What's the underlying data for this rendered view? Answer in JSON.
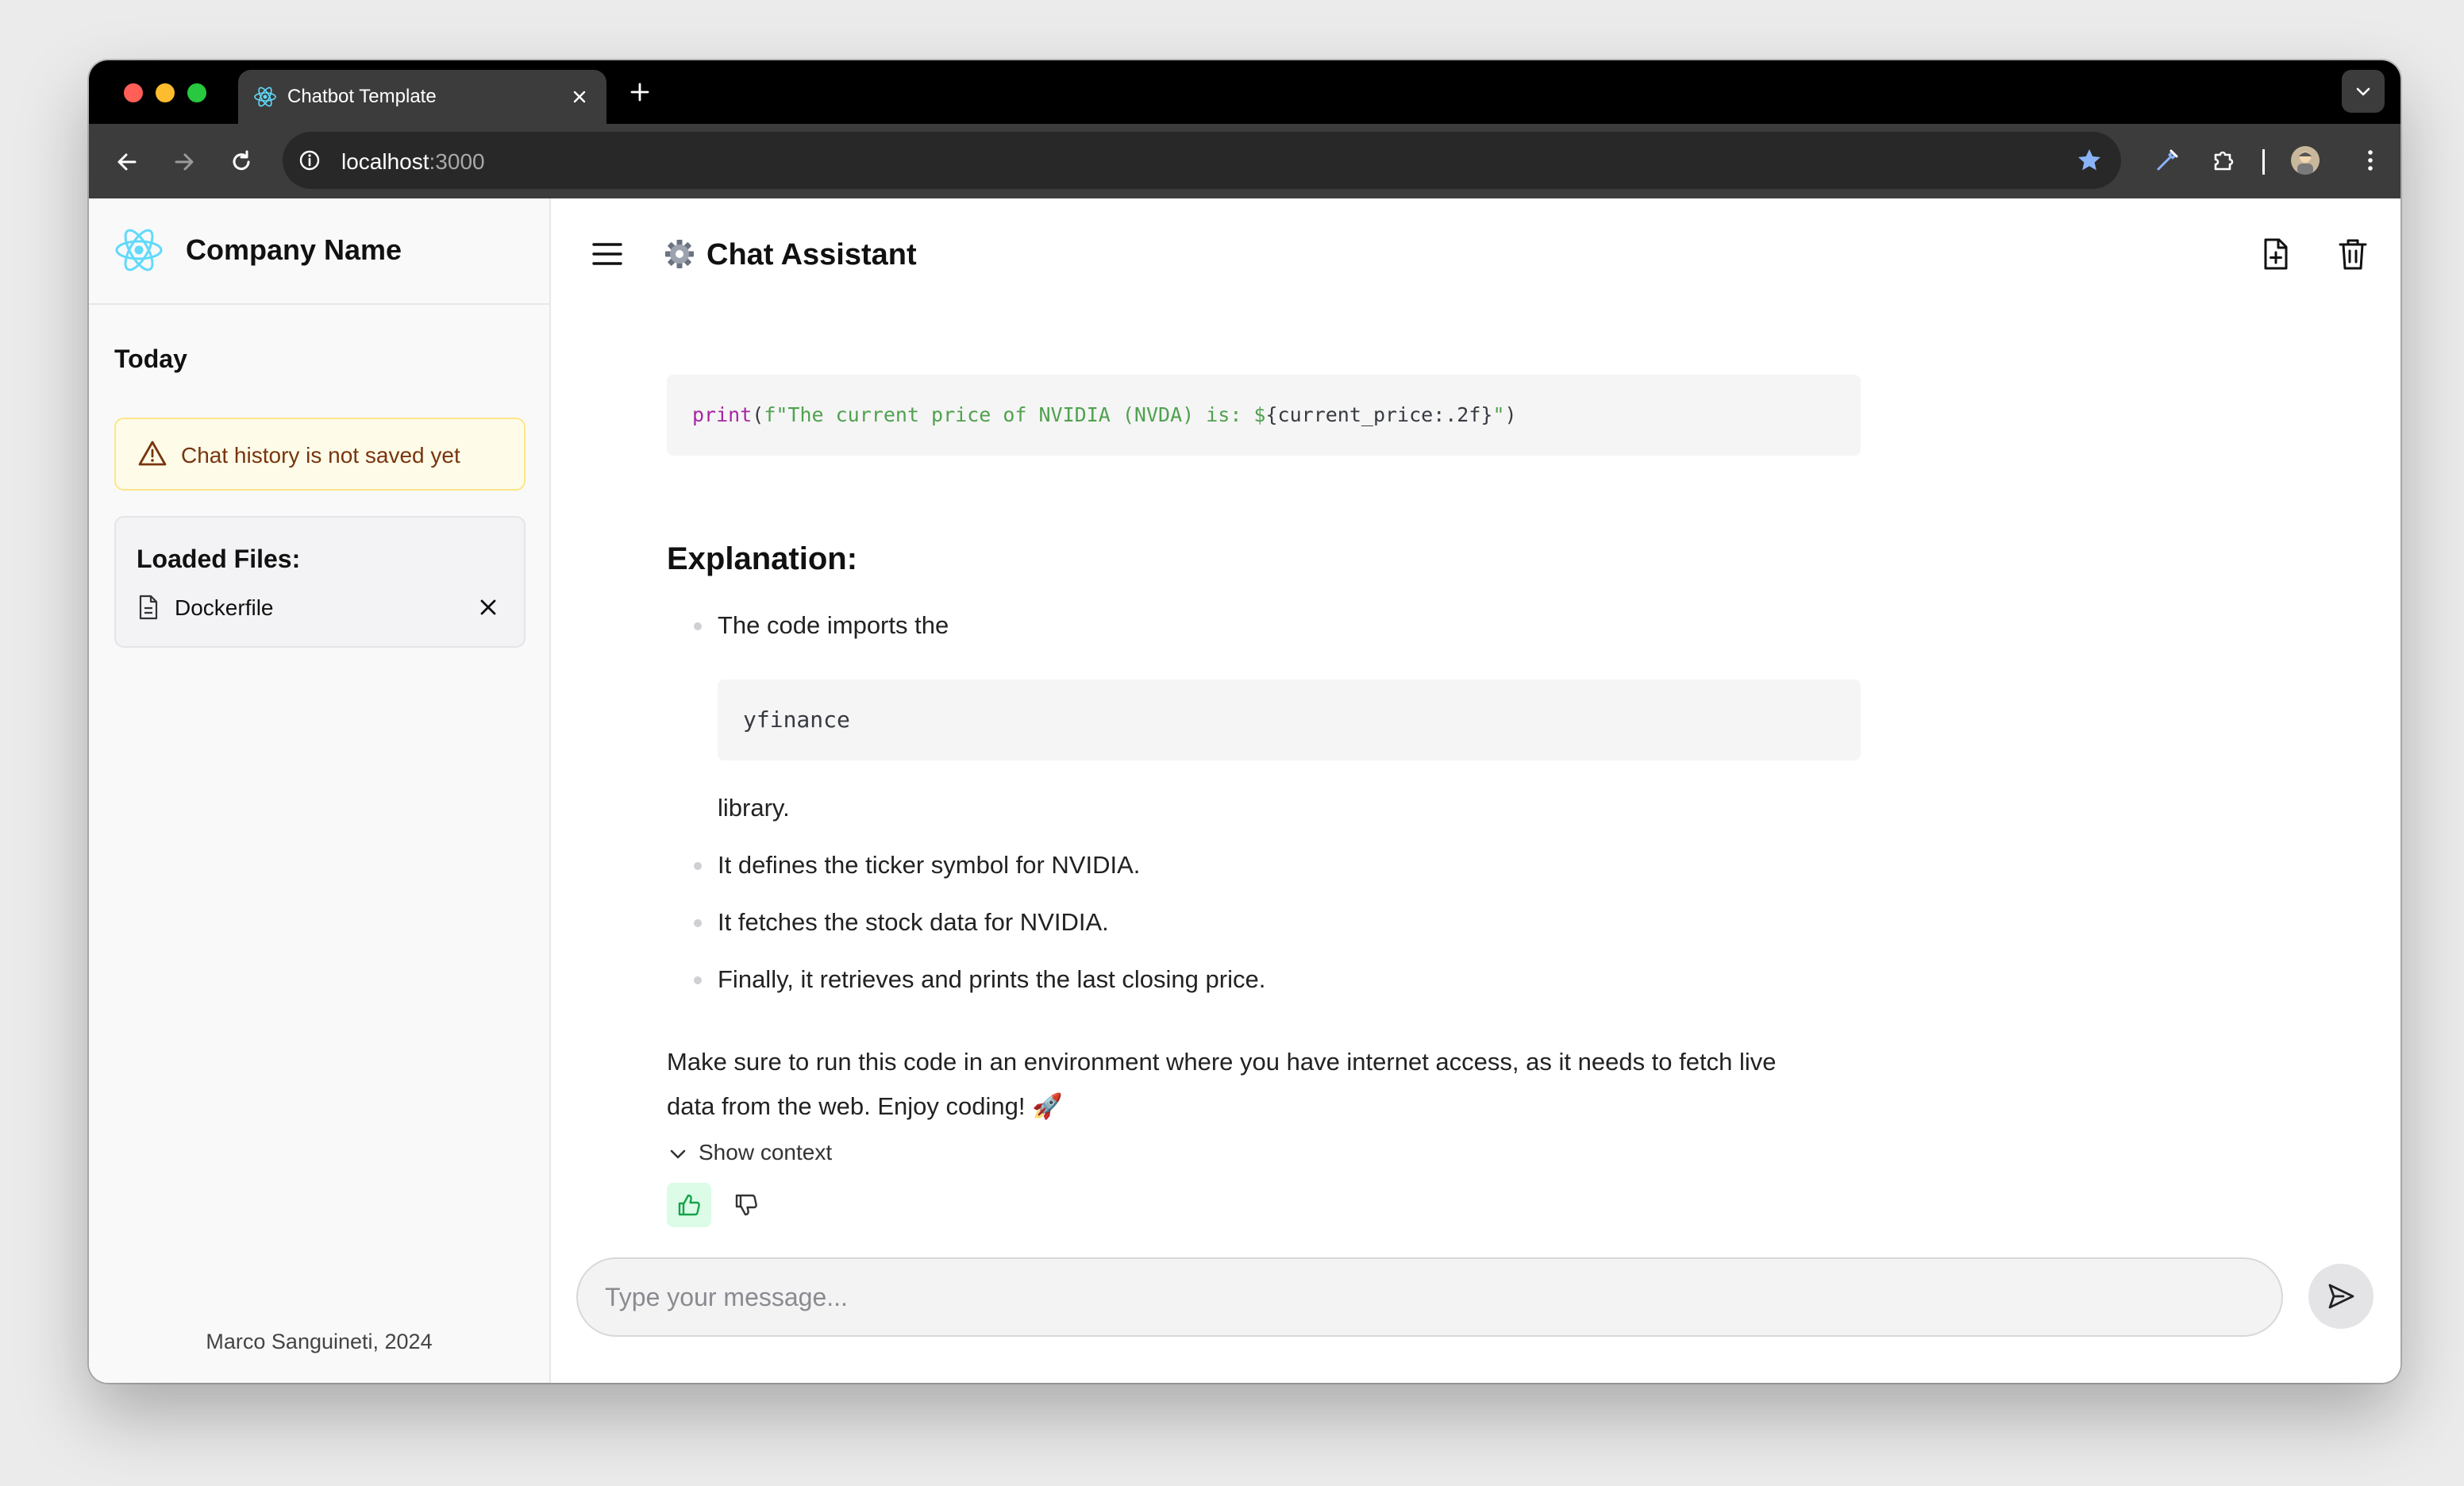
{
  "browser": {
    "tab_title": "Chatbot Template",
    "url_host": "localhost",
    "url_port": ":3000"
  },
  "sidebar": {
    "company_name": "Company Name",
    "section_today": "Today",
    "warning_text": "Chat history is not saved yet",
    "loaded_files_title": "Loaded Files:",
    "files": [
      "Dockerfile"
    ],
    "footer": "Marco Sanguineti, 2024"
  },
  "header": {
    "title": "Chat Assistant"
  },
  "message": {
    "code_print": {
      "fn": "print",
      "open": "(",
      "string_part": "f\"The current price of NVIDIA (NVDA) is: $",
      "expr_part": "{current_price:.2f}",
      "close_quote": "\"",
      "close": ")"
    },
    "explanation_heading": "Explanation:",
    "bullet_1_before": "The code imports the",
    "bullet_1_code": "yfinance",
    "bullet_1_after": "library.",
    "bullet_2": "It defines the ticker symbol for NVIDIA.",
    "bullet_3": "It fetches the stock data for NVIDIA.",
    "bullet_4": "Finally, it retrieves and prints the last closing price.",
    "closing_line_1": "Make sure to run this code in an environment where you have internet access, as it needs to fetch live",
    "closing_line_2": "data from the web. Enjoy coding! 🚀",
    "show_context": "Show context"
  },
  "input": {
    "placeholder": "Type your message..."
  },
  "colors": {
    "accent_react": "#61dafb",
    "feedback_active": "#16a34a",
    "warning_bg": "#fefce8"
  },
  "icons": [
    "react-logo-icon",
    "close-icon",
    "plus-icon",
    "chevron-down-icon",
    "back-arrow-icon",
    "forward-arrow-icon",
    "reload-icon",
    "info-icon",
    "bookmark-star-icon",
    "eyedropper-icon",
    "extensions-icon",
    "kebab-menu-icon",
    "hamburger-icon",
    "gear-icon",
    "new-file-icon",
    "trash-icon",
    "moon-icon",
    "warning-triangle-icon",
    "file-icon",
    "thumbs-up-icon",
    "thumbs-down-icon",
    "send-icon"
  ]
}
